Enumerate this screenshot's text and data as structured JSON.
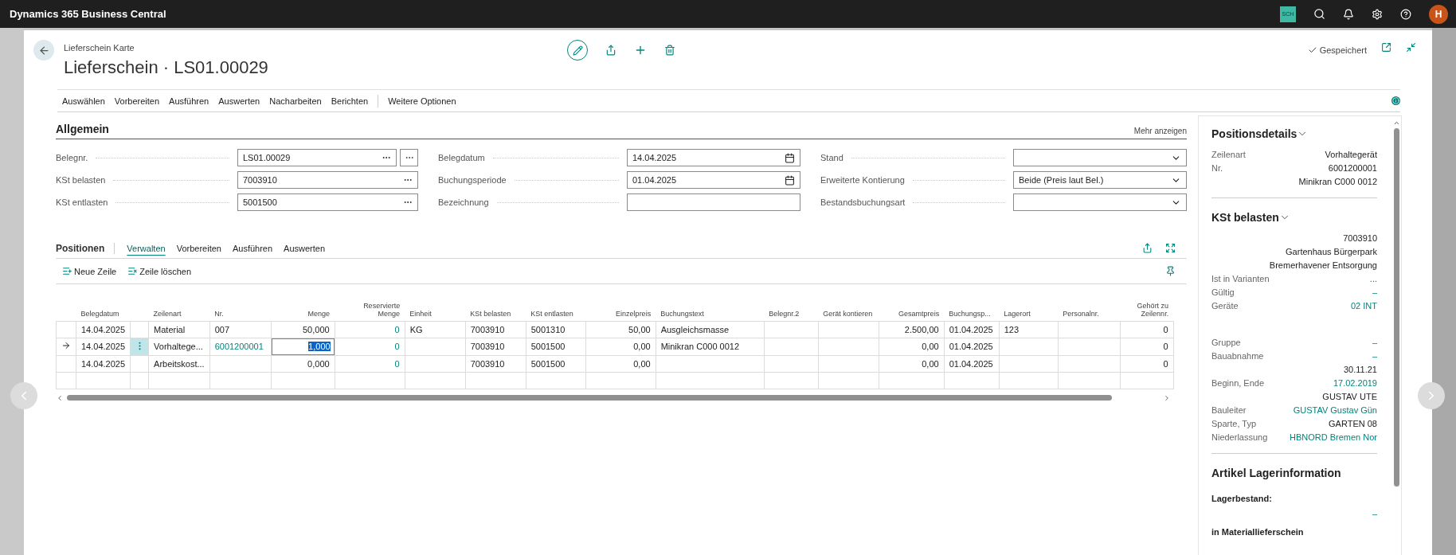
{
  "app_bar": {
    "title": "Dynamics 365 Business Central",
    "company_badge": "SCH",
    "user_initial": "H"
  },
  "header": {
    "breadcrumb": "Lieferschein Karte",
    "title": "Lieferschein · LS01.00029",
    "status": "Gespeichert"
  },
  "action_menu": {
    "items": [
      "Auswählen",
      "Vorbereiten",
      "Ausführen",
      "Auswerten",
      "Nacharbeiten",
      "Berichten"
    ],
    "more": "Weitere Optionen"
  },
  "general": {
    "title": "Allgemein",
    "more": "Mehr anzeigen",
    "columns": [
      [
        {
          "label": "Belegnr.",
          "value": "LS01.00029",
          "kind": "lookup",
          "assist_button": true
        },
        {
          "label": "KSt belasten",
          "value": "7003910",
          "kind": "lookup",
          "assist_button": false
        },
        {
          "label": "KSt entlasten",
          "value": "5001500",
          "kind": "lookup",
          "assist_button": false
        }
      ],
      [
        {
          "label": "Belegdatum",
          "value": "14.04.2025",
          "kind": "date",
          "assist_button": false
        },
        {
          "label": "Buchungsperiode",
          "value": "01.04.2025",
          "kind": "date",
          "assist_button": false
        },
        {
          "label": "Bezeichnung",
          "kind": "text",
          "assist_button": false
        }
      ],
      [
        {
          "label": "Stand",
          "kind": "select",
          "assist_button": false
        },
        {
          "label": "Erweiterte Kontierung",
          "value": "Beide (Preis laut Bel.)",
          "kind": "select",
          "assist_button": false
        },
        {
          "label": "Bestandsbuchungsart",
          "kind": "select",
          "assist_button": false
        }
      ]
    ]
  },
  "lines": {
    "title": "Positionen",
    "tabs": [
      {
        "label": "Verwalten",
        "selected": true
      },
      {
        "label": "Vorbereiten",
        "selected": false
      },
      {
        "label": "Ausführen",
        "selected": false
      },
      {
        "label": "Auswerten",
        "selected": false
      }
    ],
    "actions": [
      {
        "label": "Neue Zeile",
        "kind": "new"
      },
      {
        "label": "Zeile löschen",
        "kind": "delete"
      }
    ],
    "columns": [
      "Belegdatum",
      "Zeilenart",
      "Nr.",
      "Menge",
      "Reservierte Menge",
      "Einheit",
      "KSt belasten",
      "KSt entlasten",
      "Einzelpreis",
      "Buchungstext",
      "Belegnr.2",
      "Gerät kontieren",
      "Gesamtpreis",
      "Buchungsp...",
      "Lagerort",
      "Personalnr.",
      "Gehört zu Zeilennr."
    ],
    "rows": [
      {
        "current": false,
        "cells": [
          "14.04.2025",
          "Material",
          "007",
          "50,000",
          {
            "text": "0",
            "link": true
          },
          "KG",
          "7003910",
          "5001310",
          "50,00",
          "Ausgleichsmasse",
          "",
          "",
          "2.500,00",
          "01.04.2025",
          "123",
          "",
          "0"
        ]
      },
      {
        "current": true,
        "cells": [
          "14.04.2025",
          "Vorhaltege...",
          {
            "text": "6001200001",
            "link": true
          },
          "1,000",
          {
            "text": "0",
            "link": true
          },
          "",
          "7003910",
          "5001500",
          "0,00",
          "Minikran C000 0012",
          "",
          "",
          "0,00",
          "01.04.2025",
          "",
          "",
          "0"
        ]
      },
      {
        "current": false,
        "cells": [
          "14.04.2025",
          "Arbeitskost...",
          "",
          "0,000",
          {
            "text": "0",
            "link": true
          },
          "",
          "7003910",
          "5001500",
          "0,00",
          "",
          "",
          "",
          "0,00",
          "01.04.2025",
          "",
          "",
          "0"
        ]
      }
    ]
  },
  "factbox": {
    "sections": [
      {
        "title": "Positionsdetails",
        "collapsible": true,
        "rows": [
          {
            "label": "Zeilenart",
            "value": "Vorhaltegerät"
          },
          {
            "label": "Nr.",
            "value": "6001200001"
          },
          {
            "value": "Minikran C000 0012"
          }
        ]
      },
      {
        "title": "KSt belasten",
        "collapsible": true,
        "rows": [
          {
            "value": "7003910"
          },
          {
            "value": "Gartenhaus Bürgerpark"
          },
          {
            "value": "Bremerhavener Entsorgung"
          },
          {
            "label": "Ist in Varianten",
            "value": "...",
            "link": true
          },
          {
            "label": "Gültig",
            "value": "–",
            "link": true
          },
          {
            "label": "Geräte",
            "value": "02 INT",
            "link": true
          },
          {
            "label": "Gruppe",
            "value": "–",
            "link": true,
            "gap_before": true
          },
          {
            "label": "Bauabnahme",
            "value": "–",
            "link": true
          },
          {
            "value": "30.11.21"
          },
          {
            "label": "Beginn, Ende",
            "value": "17.02.2019",
            "link": true
          },
          {
            "value": "GUSTAV UTE"
          },
          {
            "label": "Bauleiter",
            "value": "GUSTAV Gustav Gün",
            "link": true
          },
          {
            "label": "Sparte, Typ",
            "value": "GARTEN 08"
          },
          {
            "label": "Niederlassung",
            "value": "HBNORD Bremen Nor",
            "link": true
          }
        ]
      },
      {
        "title": "Artikel Lagerinformation",
        "collapsible": false,
        "rows": [
          {
            "label": "Lagerbestand:",
            "bold": true
          },
          {
            "value": "–",
            "link": true
          },
          {
            "label": "in Materiallieferschein",
            "bold": true
          }
        ]
      }
    ]
  }
}
